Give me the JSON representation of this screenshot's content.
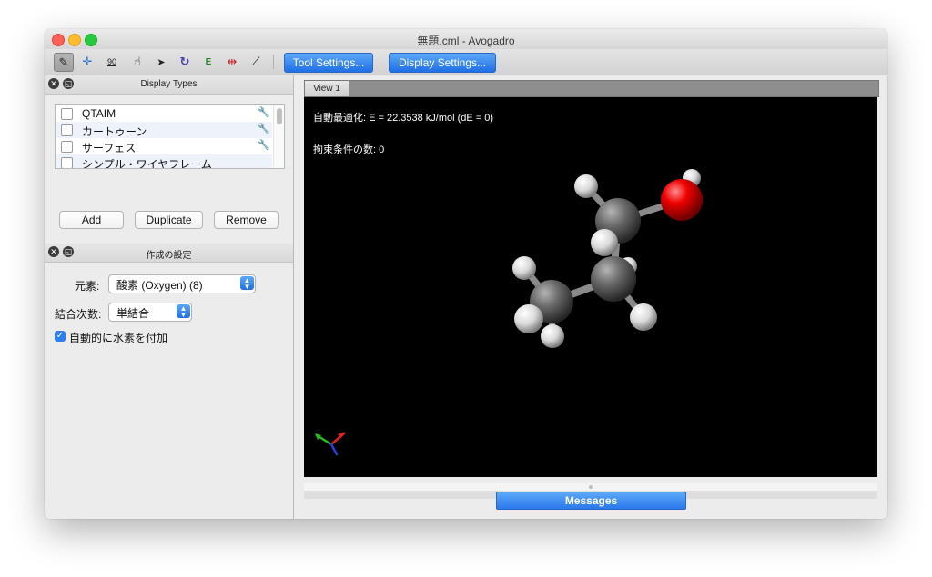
{
  "window": {
    "title": "無題.cml - Avogadro"
  },
  "toolbar": {
    "tools": [
      {
        "name": "draw-tool",
        "icon": "pencil-icon",
        "glyph": "✎",
        "active": true
      },
      {
        "name": "navigate-tool",
        "icon": "crosshair-icon",
        "glyph": "✛"
      },
      {
        "name": "measure-tool",
        "icon": "measure-icon",
        "glyph": "90"
      },
      {
        "name": "manipulate-tool",
        "icon": "hand-icon",
        "glyph": "☝"
      },
      {
        "name": "select-tool",
        "icon": "arrow-icon",
        "glyph": "➤"
      },
      {
        "name": "rotate-tool",
        "icon": "rotate-icon",
        "glyph": "↻"
      },
      {
        "name": "optimize-tool",
        "icon": "energy-icon",
        "glyph": "E"
      },
      {
        "name": "align-tool",
        "icon": "align-icon",
        "glyph": "⇹"
      },
      {
        "name": "bond-tool",
        "icon": "bond-icon",
        "glyph": "⟋"
      }
    ],
    "tool_settings_label": "Tool Settings...",
    "display_settings_label": "Display Settings..."
  },
  "display_types": {
    "title": "Display Types",
    "items": [
      {
        "label": "QTAIM",
        "checked": false,
        "has_settings": true
      },
      {
        "label": "カートゥーン",
        "checked": false,
        "has_settings": true
      },
      {
        "label": "サーフェス",
        "checked": false,
        "has_settings": true
      },
      {
        "label": "シンプル・ワイヤフレーム",
        "checked": false,
        "has_settings": false
      }
    ],
    "add_label": "Add",
    "duplicate_label": "Duplicate",
    "remove_label": "Remove"
  },
  "draw_settings": {
    "title": "作成の設定",
    "element_label": "元素:",
    "element_value": "酸素 (Oxygen) (8)",
    "bond_order_label": "結合次数:",
    "bond_order_value": "単結合",
    "auto_hydrogen_label": "自動的に水素を付加",
    "auto_hydrogen_checked": true
  },
  "view": {
    "tab_label": "View 1",
    "energy_text": "自動最適化: E = 22.3538 kJ/mol (dE = 0)",
    "constraints_text": "拘束条件の数: 0",
    "background": "#000000"
  },
  "messages": {
    "label": "Messages"
  },
  "colors": {
    "accent": "#2a78ec",
    "carbon": "#5a5a5a",
    "hydrogen": "#e8e8e8",
    "oxygen": "#e00000"
  }
}
